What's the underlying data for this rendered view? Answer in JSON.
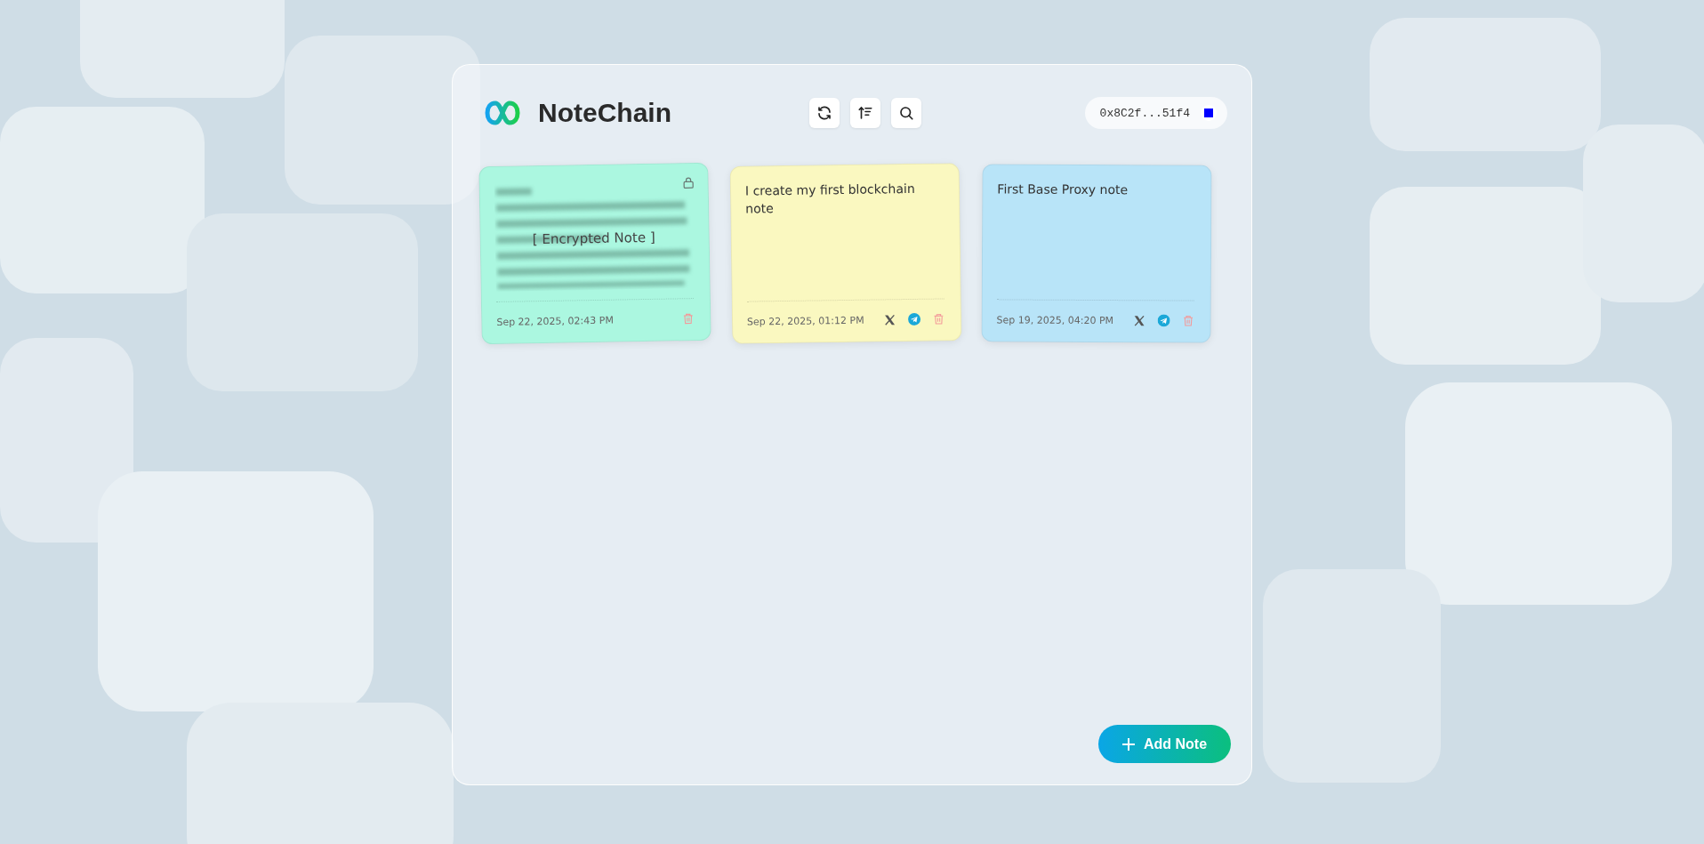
{
  "app": {
    "title": "NoteChain"
  },
  "toolbar": [
    {
      "kind": "refresh"
    },
    {
      "kind": "sort"
    },
    {
      "kind": "search"
    }
  ],
  "wallet": {
    "address": "0x8C2f...51f4"
  },
  "notes": [
    {
      "kind": "encrypted",
      "label": "[ Encrypted Note ]",
      "date": "Sep 22, 2025, 02:43 PM",
      "color": "#abf7e0",
      "shareable": false
    },
    {
      "kind": "plain",
      "text": "I create my first blockchain note",
      "date": "Sep 22, 2025, 01:12 PM",
      "color": "#faf8c0",
      "shareable": true
    },
    {
      "kind": "plain",
      "text": "First Base Proxy note",
      "date": "Sep 19, 2025, 04:20 PM",
      "color": "#b8e4f8",
      "shareable": true
    }
  ],
  "add_button": {
    "label": "Add Note"
  }
}
